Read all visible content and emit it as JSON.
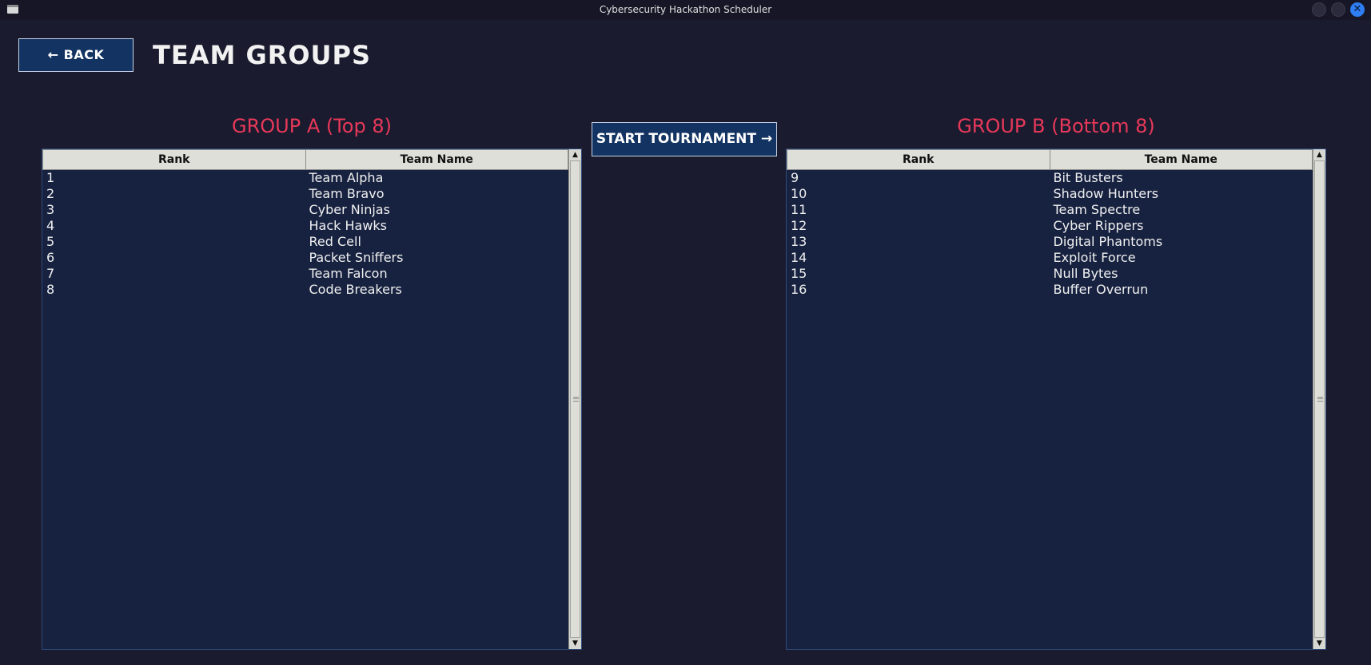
{
  "window": {
    "title": "Cybersecurity Hackathon Scheduler"
  },
  "header": {
    "back_label": "← BACK",
    "title": "TEAM GROUPS"
  },
  "actions": {
    "start_label": "START TOURNAMENT →"
  },
  "group_a": {
    "heading": "GROUP A (Top 8)",
    "columns": [
      "Rank",
      "Team Name"
    ],
    "rows": [
      {
        "rank": "1",
        "name": "Team Alpha"
      },
      {
        "rank": "2",
        "name": "Team Bravo"
      },
      {
        "rank": "3",
        "name": "Cyber Ninjas"
      },
      {
        "rank": "4",
        "name": "Hack Hawks"
      },
      {
        "rank": "5",
        "name": "Red Cell"
      },
      {
        "rank": "6",
        "name": "Packet Sniffers"
      },
      {
        "rank": "7",
        "name": "Team Falcon"
      },
      {
        "rank": "8",
        "name": "Code Breakers"
      }
    ]
  },
  "group_b": {
    "heading": "GROUP B (Bottom 8)",
    "columns": [
      "Rank",
      "Team Name"
    ],
    "rows": [
      {
        "rank": "9",
        "name": "Bit Busters"
      },
      {
        "rank": "10",
        "name": "Shadow Hunters"
      },
      {
        "rank": "11",
        "name": "Team Spectre"
      },
      {
        "rank": "12",
        "name": "Cyber Rippers"
      },
      {
        "rank": "13",
        "name": "Digital Phantoms"
      },
      {
        "rank": "14",
        "name": "Exploit Force"
      },
      {
        "rank": "15",
        "name": "Null Bytes"
      },
      {
        "rank": "16",
        "name": "Buffer Overrun"
      }
    ]
  },
  "colors": {
    "background": "#1a1b2e",
    "table_background": "#172240",
    "button_background": "#133463",
    "heading_accent": "#e8385a",
    "close_button": "#2f7ef5"
  }
}
